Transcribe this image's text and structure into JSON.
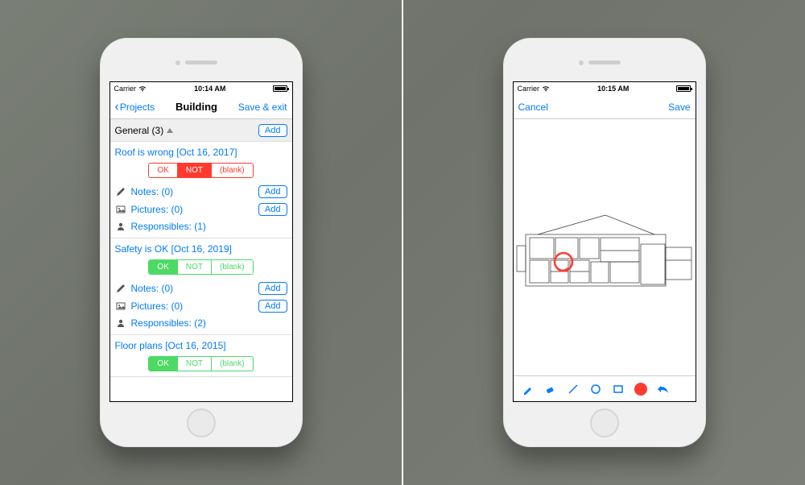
{
  "left": {
    "status": {
      "carrier": "Carrier",
      "time": "10:14 AM"
    },
    "nav": {
      "back": "Projects",
      "title": "Building",
      "action": "Save & exit"
    },
    "section": {
      "label": "General (3)",
      "add": "Add"
    },
    "items": [
      {
        "title": "Roof is wrong [Oct 16, 2017]",
        "seg_variant": "red",
        "seg": [
          "OK",
          "NOT",
          "(blank)"
        ],
        "seg_active": 1,
        "rows": [
          {
            "icon": "pencil-icon",
            "label": "Notes: (0)",
            "add": "Add"
          },
          {
            "icon": "picture-icon",
            "label": "Pictures: (0)",
            "add": "Add"
          },
          {
            "icon": "person-icon",
            "label": "Responsibles: (1)",
            "add": null
          }
        ]
      },
      {
        "title": "Safety is OK [Oct 16, 2019]",
        "seg_variant": "green",
        "seg": [
          "OK",
          "NOT",
          "(blank)"
        ],
        "seg_active": 0,
        "rows": [
          {
            "icon": "pencil-icon",
            "label": "Notes: (0)",
            "add": "Add"
          },
          {
            "icon": "picture-icon",
            "label": "Pictures: (0)",
            "add": "Add"
          },
          {
            "icon": "person-icon",
            "label": "Responsibles: (2)",
            "add": null
          }
        ]
      },
      {
        "title": "Floor plans [Oct 16, 2015]",
        "seg_variant": "green",
        "seg": [
          "OK",
          "NOT",
          "(blank)"
        ],
        "seg_active": 0,
        "rows": []
      }
    ]
  },
  "right": {
    "status": {
      "carrier": "Carrier",
      "time": "10:15 AM"
    },
    "nav": {
      "cancel": "Cancel",
      "save": "Save"
    },
    "annotation": {
      "color": "#ff3b30",
      "shape": "circle"
    },
    "tools": [
      "brush",
      "eraser",
      "line",
      "circle",
      "rect",
      "color",
      "undo"
    ]
  }
}
